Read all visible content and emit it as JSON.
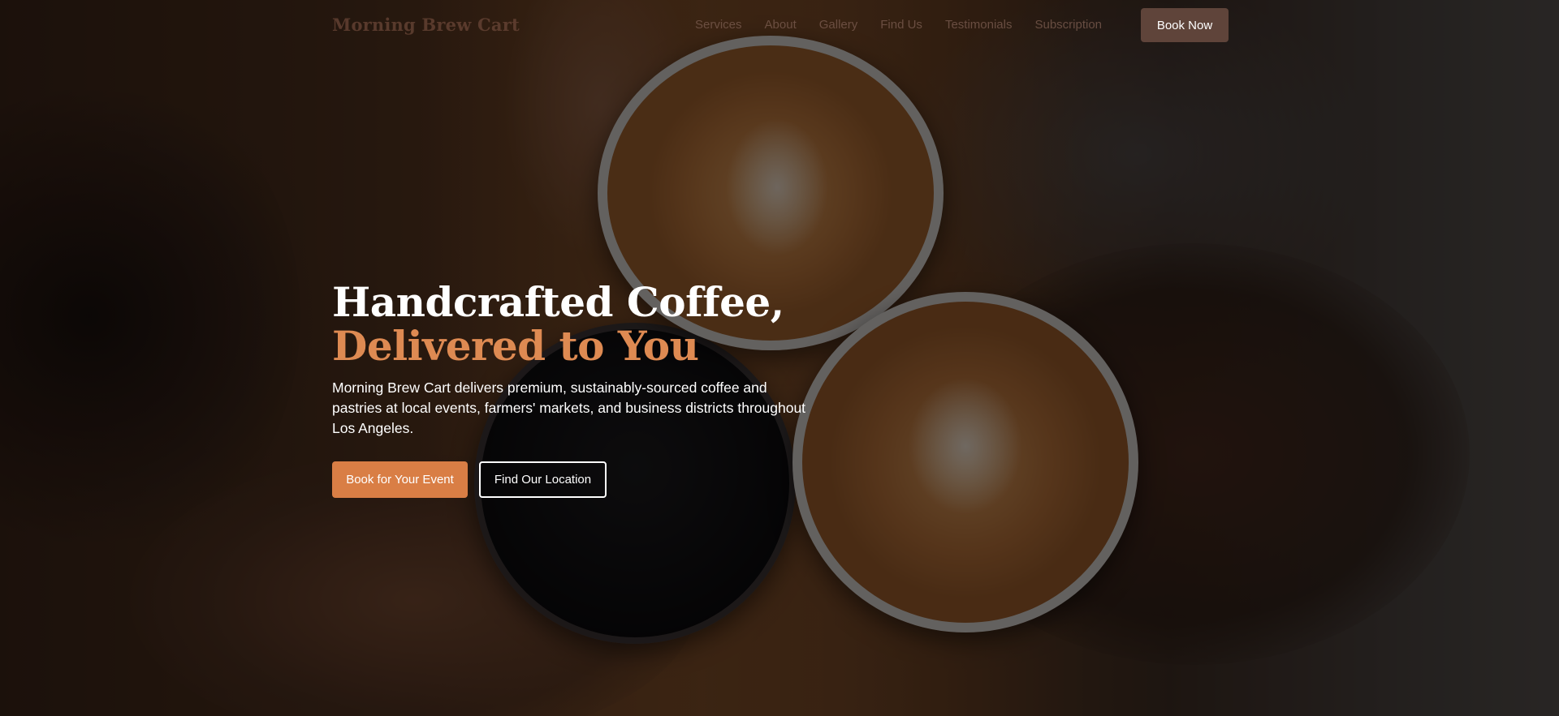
{
  "nav": {
    "brand": "Morning Brew Cart",
    "links": [
      {
        "label": "Services"
      },
      {
        "label": "About"
      },
      {
        "label": "Gallery"
      },
      {
        "label": "Find Us"
      },
      {
        "label": "Testimonials"
      },
      {
        "label": "Subscription"
      }
    ],
    "cta_label": "Book Now"
  },
  "hero": {
    "headline_line1": "Handcrafted Coffee,",
    "headline_line2": "Delivered to You",
    "description": "Morning Brew Cart delivers premium, sustainably-sourced coffee and pastries at local events, farmers' markets, and business districts throughout Los Angeles.",
    "primary_button": "Book for Your Event",
    "secondary_button": "Find Our Location"
  },
  "colors": {
    "accent": "#de8a52",
    "primary_button": "#d97e45",
    "nav_cta": "#5f443a",
    "text": "#ffffff"
  }
}
